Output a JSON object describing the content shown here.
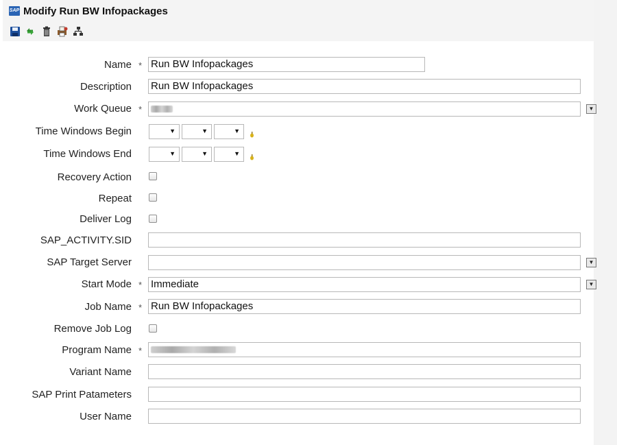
{
  "window": {
    "title": "Modify Run BW Infopackages",
    "logo_text": "SAP"
  },
  "toolbar": {
    "icons": [
      "save-icon",
      "refresh-icon",
      "delete-icon",
      "print-icon",
      "hierarchy-icon"
    ]
  },
  "required_marker": "*",
  "fields": {
    "name": {
      "label": "Name",
      "value": "Run BW Infopackages"
    },
    "description": {
      "label": "Description",
      "value": "Run BW Infopackages"
    },
    "work_queue": {
      "label": "Work Queue",
      "value": ""
    },
    "time_begin": {
      "label": "Time Windows Begin"
    },
    "time_end": {
      "label": "Time Windows End"
    },
    "recovery_action": {
      "label": "Recovery Action",
      "checked": false
    },
    "repeat": {
      "label": "Repeat",
      "checked": false
    },
    "deliver_log": {
      "label": "Deliver Log",
      "checked": false
    },
    "sap_activity_sid": {
      "label": "SAP_ACTIVITY.SID",
      "value": ""
    },
    "sap_target_server": {
      "label": "SAP Target Server",
      "value": ""
    },
    "start_mode": {
      "label": "Start Mode",
      "value": "Immediate"
    },
    "job_name": {
      "label": "Job Name",
      "value": "Run BW Infopackages"
    },
    "remove_job_log": {
      "label": "Remove Job Log",
      "checked": false
    },
    "program_name": {
      "label": "Program Name",
      "value": ""
    },
    "variant_name": {
      "label": "Variant Name",
      "value": ""
    },
    "sap_print_parameters": {
      "label": "SAP Print Patameters",
      "value": ""
    },
    "user_name": {
      "label": "User Name",
      "value": ""
    }
  },
  "colors": {
    "sap_blue": "#2a64b4",
    "save_blue": "#1d4f9c",
    "refresh_green": "#2e8b2e",
    "clock_yellow": "#d8b21a"
  }
}
